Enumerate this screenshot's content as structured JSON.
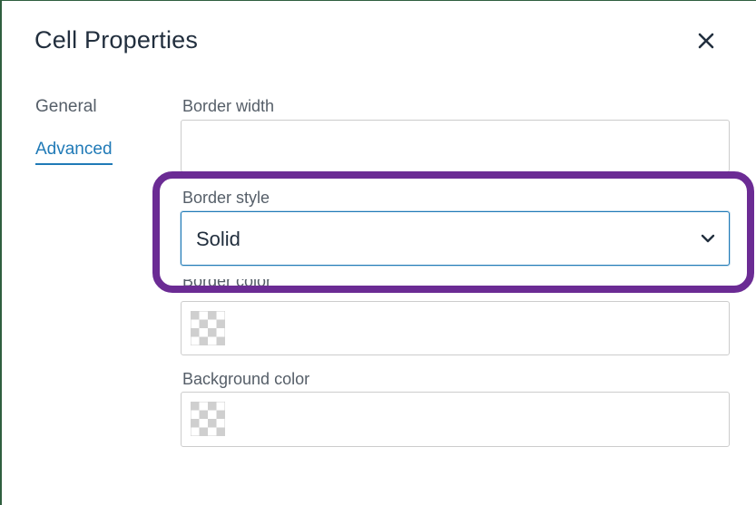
{
  "dialog": {
    "title": "Cell Properties",
    "close_icon": "close-icon"
  },
  "tabs": [
    {
      "label": "General",
      "active": false
    },
    {
      "label": "Advanced",
      "active": true
    }
  ],
  "fields": {
    "border_width": {
      "label": "Border width",
      "value": ""
    },
    "border_style": {
      "label": "Border style",
      "value": "Solid",
      "icon": "chevron-down-icon"
    },
    "border_color": {
      "label": "Border color",
      "value": "",
      "icon": "checkerboard-swatch-icon"
    },
    "background_color": {
      "label": "Background color",
      "value": "",
      "icon": "checkerboard-swatch-icon"
    }
  },
  "colors": {
    "accent": "#207ab7",
    "highlight": "#6b2b94",
    "text": "#222f3e",
    "muted_text": "#555e68"
  }
}
